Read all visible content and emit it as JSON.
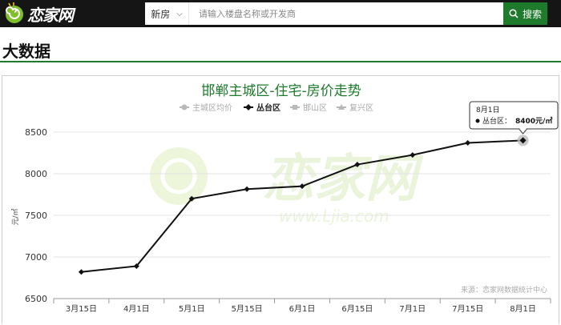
{
  "header": {
    "logo_text": "恋家网",
    "search_type": "新房",
    "search_placeholder": "请输入楼盘名称或开发商",
    "search_button": "搜索"
  },
  "section": {
    "title": "大数据"
  },
  "chart_data": {
    "type": "line",
    "title": "邯郸主城区-住宅-房价走势",
    "ylabel": "元/㎡",
    "xlabel": "",
    "categories": [
      "3月15日",
      "4月1日",
      "5月1日",
      "5月15日",
      "6月1日",
      "6月15日",
      "7月1日",
      "7月15日",
      "8月1日"
    ],
    "ylim": [
      6500,
      8500
    ],
    "yticks": [
      6500,
      7000,
      7500,
      8000,
      8500
    ],
    "legend": [
      {
        "name": "主城区均价",
        "active": false
      },
      {
        "name": "丛台区",
        "active": true
      },
      {
        "name": "邯山区",
        "active": false
      },
      {
        "name": "复兴区",
        "active": false
      }
    ],
    "series": [
      {
        "name": "丛台区",
        "values": [
          6820,
          6890,
          7700,
          7815,
          7850,
          8110,
          8225,
          8370,
          8400
        ]
      }
    ],
    "tooltip": {
      "date": "8月1日",
      "series": "丛台区",
      "value_text": "8400元/㎡"
    },
    "source_text": "来源：恋家网数据统计中心",
    "watermark": "恋家网",
    "watermark_url": "www.Ljia.com",
    "colors": {
      "line": "#111111",
      "title": "#1e7b2b",
      "inactive": "#b8b8b8",
      "grid": "#e3e3e3"
    }
  }
}
